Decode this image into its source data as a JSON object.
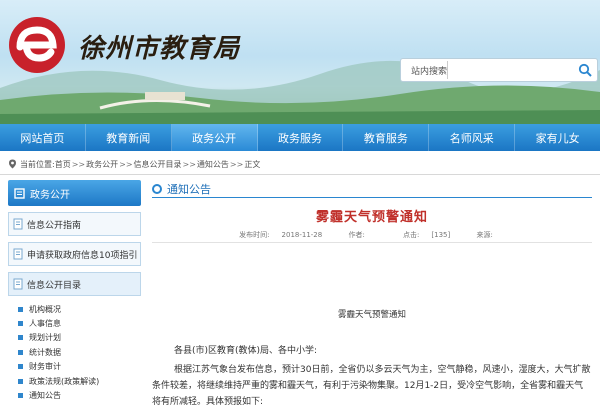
{
  "site": {
    "logo_text": "徐州市教育局"
  },
  "search": {
    "label": "站内搜索",
    "placeholder": ""
  },
  "nav": {
    "items": [
      {
        "label": "网站首页"
      },
      {
        "label": "教育新闻"
      },
      {
        "label": "政务公开"
      },
      {
        "label": "政务服务"
      },
      {
        "label": "教育服务"
      },
      {
        "label": "名师风采"
      },
      {
        "label": "家有儿女"
      }
    ],
    "active_index": 2
  },
  "breadcrumb": {
    "prefix": "当前位置:",
    "items": [
      "首页",
      "政务公开",
      "信息公开目录",
      "通知公告",
      "正文"
    ],
    "separator": ">>"
  },
  "sidebar": {
    "head": "政务公开",
    "cards": [
      "信息公开指南",
      "申请获取政府信息10项指引",
      "信息公开目录"
    ],
    "list": [
      "机构概况",
      "人事信息",
      "规划计划",
      "统计数据",
      "财务审计",
      "政策法规(政策解读)",
      "通知公告"
    ]
  },
  "main": {
    "section_title": "通知公告",
    "article_title": "雾霾天气预警通知",
    "meta": {
      "date_label": "发布时间:",
      "date": "2018-11-28",
      "author_label": "作者:",
      "author": "",
      "clicks_label": "点击:",
      "clicks": "[135]",
      "source_label": "来源:",
      "source": ""
    },
    "subtitle": "雾霾天气预警通知",
    "salutation": "各县(市)区教育(教体)局、各中小学:",
    "paragraph": "根据江苏气象台发布信息，预计30日前，全省仍以多云天气为主，空气静稳，风速小，湿度大，大气扩散条件较差，将继续维持严重的雾和霾天气，有利于污染物集聚。12月1-2日，受冷空气影响，全省雾和霾天气将有所减轻。具体预报如下:"
  },
  "colors": {
    "nav_blue": "#1b76c4",
    "title_red": "#c0302a",
    "link_blue": "#1e6fb8"
  },
  "icons": [
    "logo-e-icon",
    "search-icon",
    "location-pin-icon",
    "dot-circle-icon",
    "doc-icon"
  ]
}
